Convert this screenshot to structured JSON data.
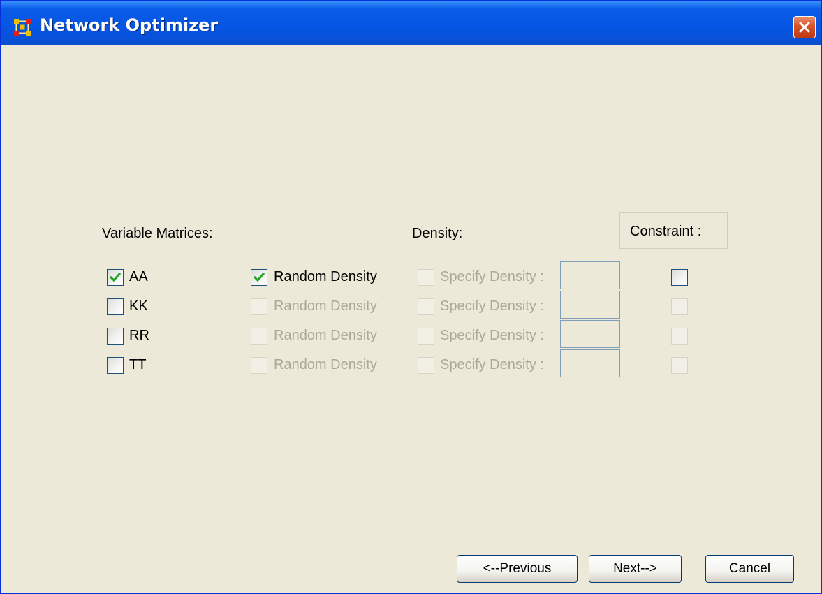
{
  "window": {
    "title": "Network Optimizer"
  },
  "headers": {
    "variable_matrices": "Variable Matrices:",
    "density": "Density:",
    "constraint": "Constraint :"
  },
  "rows": [
    {
      "matrix": "AA",
      "matrix_checked": true,
      "random_density": "Random Density",
      "random_checked": true,
      "random_enabled": true,
      "specify_density": "Specify Density :",
      "specify_enabled": false,
      "density_value": "",
      "constraint_checked": false,
      "constraint_enabled": true
    },
    {
      "matrix": "KK",
      "matrix_checked": false,
      "random_density": "Random Density",
      "random_checked": false,
      "random_enabled": false,
      "specify_density": "Specify Density :",
      "specify_enabled": false,
      "density_value": "",
      "constraint_checked": false,
      "constraint_enabled": false
    },
    {
      "matrix": "RR",
      "matrix_checked": false,
      "random_density": "Random Density",
      "random_checked": false,
      "random_enabled": false,
      "specify_density": "Specify Density :",
      "specify_enabled": false,
      "density_value": "",
      "constraint_checked": false,
      "constraint_enabled": false
    },
    {
      "matrix": "TT",
      "matrix_checked": false,
      "random_density": "Random Density",
      "random_checked": false,
      "random_enabled": false,
      "specify_density": "Specify Density :",
      "specify_enabled": false,
      "density_value": "",
      "constraint_checked": false,
      "constraint_enabled": false
    }
  ],
  "buttons": {
    "previous": "<--Previous",
    "next": "Next-->",
    "cancel": "Cancel"
  },
  "icons": {
    "app": "network-grid-icon",
    "close": "close-icon",
    "check": "checkmark-icon"
  },
  "colors": {
    "title_bar": "#0554e3",
    "window_bg": "#ece9d8",
    "check": "#21a121",
    "disabled_text": "#aca899",
    "close_button": "#d9522a"
  }
}
